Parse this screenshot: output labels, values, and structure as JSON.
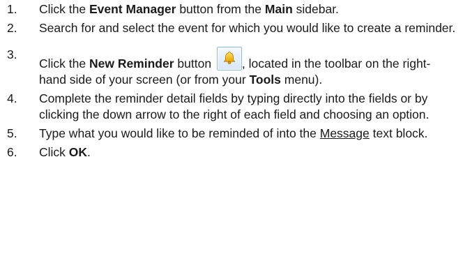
{
  "steps": [
    {
      "num": "1.",
      "parts": [
        "Click the ",
        "Event Manager",
        " button from the ",
        "Main",
        " sidebar."
      ]
    },
    {
      "num": "2.",
      "text": "Search for and select the event for which you would like to create a reminder."
    },
    {
      "num": "3.",
      "parts": [
        "Click the ",
        "New Reminder",
        " button ",
        ", located in the toolbar on the right-hand side of your screen (or from your ",
        "Tools",
        " menu)."
      ],
      "icon": "bell-icon"
    },
    {
      "num": "4.",
      "text": "Complete the reminder detail fields by typing directly into the fields or by clicking the down arrow to the right of each field and choosing an option."
    },
    {
      "num": "5.",
      "parts": [
        "Type what you would like to be reminded of into the ",
        "Message",
        " text block."
      ]
    },
    {
      "num": "6.",
      "parts": [
        "Click ",
        "OK",
        "."
      ]
    }
  ]
}
